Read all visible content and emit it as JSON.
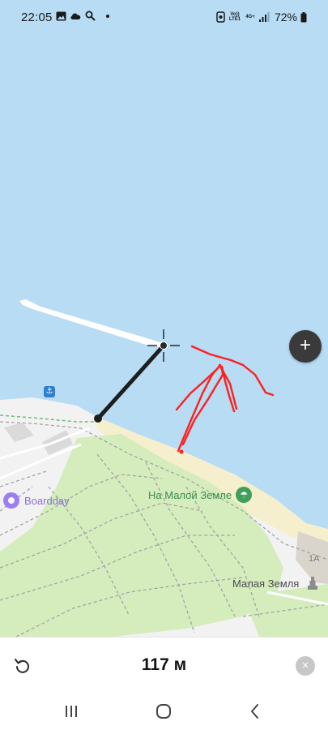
{
  "status_bar": {
    "time": "22:05",
    "net_volte": "Vo)) LTE1",
    "net_type": "4G+",
    "battery": "72%"
  },
  "map": {
    "colors": {
      "water": "#b7dcf4",
      "land": "#f2f2f2",
      "park": "#d5edbd",
      "beach": "#f6efce",
      "route": "#1e1e1e",
      "annotation": "#ff2020"
    },
    "labels": {
      "poi_boardday": "Boardday",
      "poi_beach": "На Малой Земле",
      "place_malaya_zemlya": "Малая Земля",
      "building_number": "1А"
    },
    "icons": {
      "anchor": "anchor-icon",
      "beach": "beach-umbrella-icon",
      "monument": "monument-icon"
    }
  },
  "controls": {
    "zoom_in": "+"
  },
  "ruler_panel": {
    "distance": "117 м",
    "clear": "×"
  }
}
